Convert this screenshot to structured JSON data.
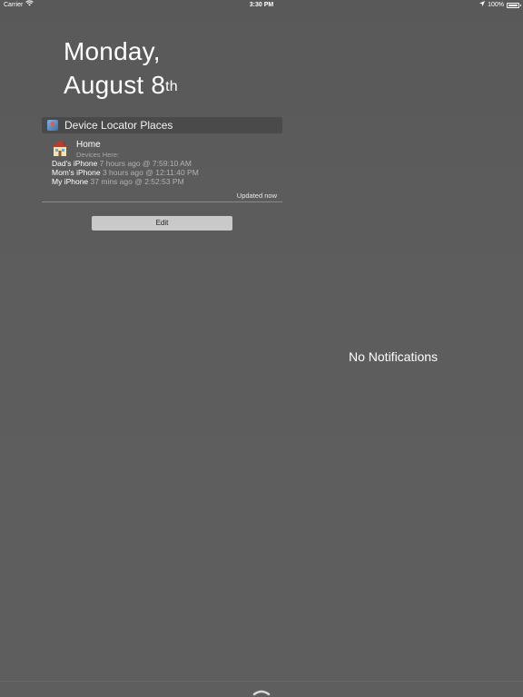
{
  "status_bar": {
    "carrier": "Carrier",
    "time": "3:30 PM",
    "battery": "100%"
  },
  "date": {
    "weekday": "Monday,",
    "month_day": "August 8",
    "ordinal": "th"
  },
  "widget": {
    "title": "Device Locator Places",
    "place": {
      "name": "Home",
      "devices_label": "Devices Here:"
    },
    "devices": [
      {
        "name": "Dad's iPhone",
        "time": "7 hours ago @ 7:59:10 AM"
      },
      {
        "name": "Mom's iPhone",
        "time": "3 hours ago @ 12:11:40 PM"
      },
      {
        "name": "My iPhone",
        "time": "37 mins ago @ 2:52:53 PM"
      }
    ],
    "updated": "Updated now"
  },
  "edit_label": "Edit",
  "notifications": {
    "empty_text": "No Notifications"
  },
  "icons": {
    "wifi": "wifi-icon",
    "location": "location-arrow-icon",
    "battery": "battery-icon",
    "app": "device-locator-app-icon",
    "home": "house-icon",
    "grabber": "chevron-grabber-icon"
  }
}
